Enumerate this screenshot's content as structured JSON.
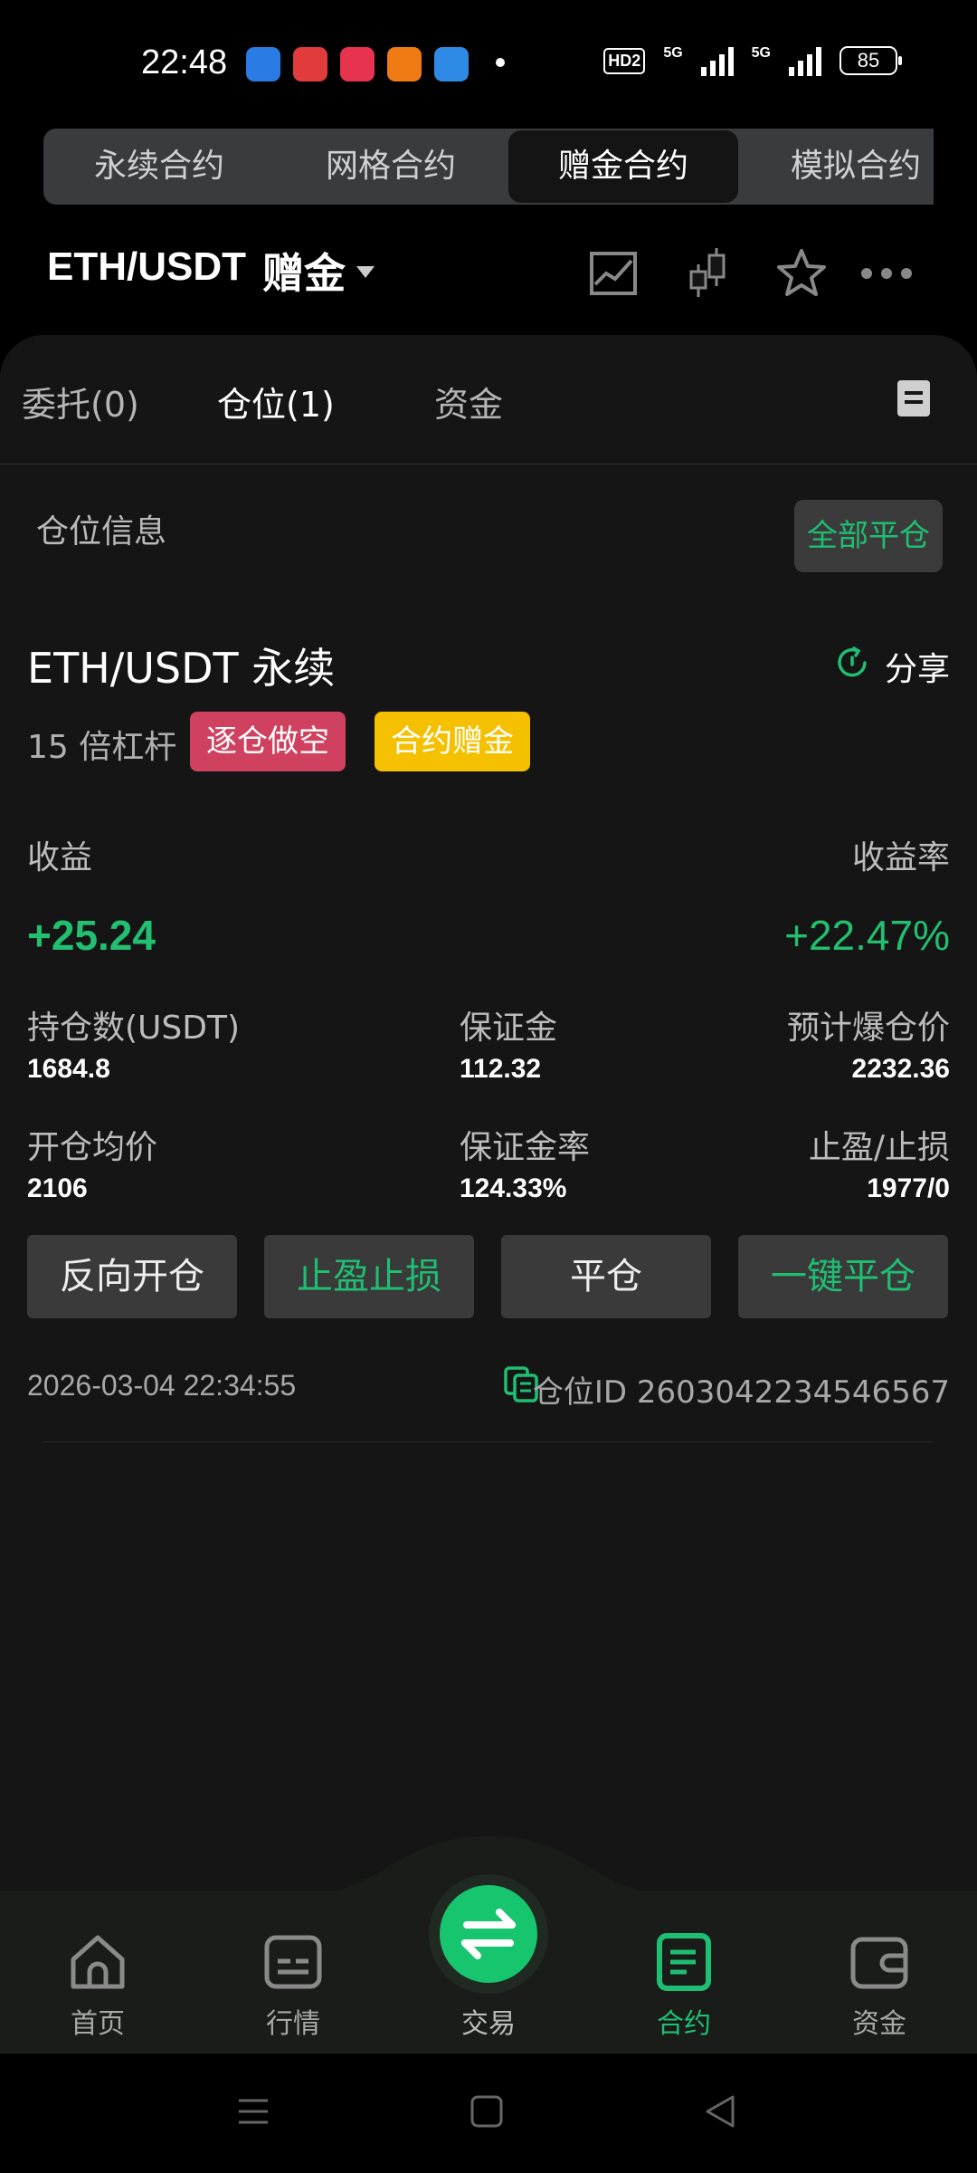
{
  "status_bar": {
    "time": "22:48",
    "hd_label": "HD2",
    "signal1": "5G",
    "signal2": "5G",
    "battery": "85",
    "app_colors": [
      "#2b7be4",
      "#e23b3b",
      "#e8334f",
      "#f07b14",
      "#2f8ae5"
    ]
  },
  "contract_tabs": [
    "永续合约",
    "网格合约",
    "赠金合约",
    "模拟合约"
  ],
  "contract_tabs_active": "赠金合约",
  "header": {
    "pair": "ETH/USDT",
    "type_label": "赠金"
  },
  "panel_tabs": {
    "orders": "委托(0)",
    "positions": "仓位(1)",
    "funds": "资金"
  },
  "section_title": "仓位信息",
  "close_all_label": "全部平仓",
  "position": {
    "title": "ETH/USDT 永续",
    "share_label": "分享",
    "leverage": "15 倍杠杆",
    "direction_badge": "逐仓做空",
    "bonus_badge": "合约赠金",
    "pnl_label": "收益",
    "pnl_value": "+25.24",
    "pnl_rate_label": "收益率",
    "pnl_rate_value": "+22.47%",
    "size_label": "持仓数(USDT)",
    "size_value": "1684.8",
    "margin_label": "保证金",
    "margin_value": "112.32",
    "liq_label": "预计爆仓价",
    "liq_value": "2232.36",
    "entry_label": "开仓均价",
    "entry_value": "2106",
    "margin_rate_label": "保证金率",
    "margin_rate_value": "124.33%",
    "tpsl_label": "止盈/止损",
    "tpsl_value": "1977/0"
  },
  "actions": {
    "reverse": "反向开仓",
    "tpsl": "止盈止损",
    "close": "平仓",
    "quick_close": "一键平仓"
  },
  "footer_info": {
    "timestamp": "2026-03-04 22:34:55",
    "position_id": "仓位ID 2603042234546567"
  },
  "bottom_nav": {
    "home": "首页",
    "market": "行情",
    "trade": "交易",
    "contract": "合约",
    "funds": "资金",
    "active": "合约"
  },
  "colors": {
    "accent_green": "#1fbf73",
    "short_red": "#d0415f",
    "bonus_yellow": "#f5c000"
  }
}
